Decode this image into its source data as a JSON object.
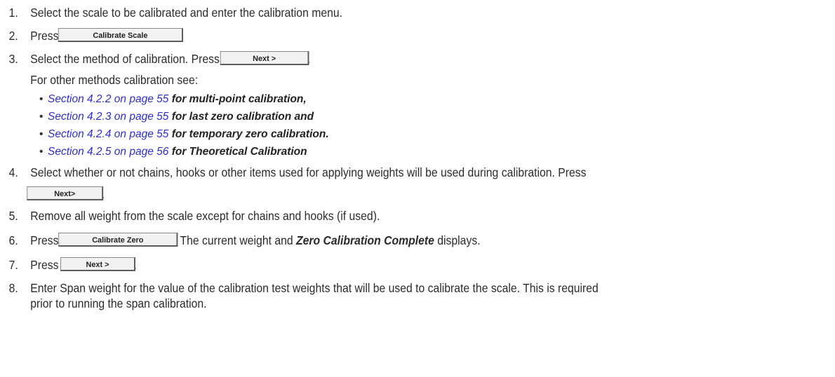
{
  "steps": [
    {
      "num": "1.",
      "text": "Select the scale to be calibrated and enter the calibration menu."
    },
    {
      "num": "2.",
      "pre": "Press",
      "button": "Calibrate Scale",
      "post": "."
    },
    {
      "num": "3.",
      "pre": "Select the method of calibration. Press",
      "button": "Next >",
      "post": "."
    },
    {
      "sub": "For other methods calibration see:"
    },
    {
      "num": "4.",
      "text": "Select whether or not chains, hooks or other items used for applying weights will be used during calibration. Press"
    },
    {
      "button_only": "Next>",
      "post": "."
    },
    {
      "num": "5.",
      "text": "Remove all weight from the scale except for chains and hooks (if used)."
    },
    {
      "num": "6.",
      "pre": "Press",
      "button": "Calibrate Zero",
      "post": ". The current weight and",
      "emph": "Zero Calibration Complete",
      "post2": "displays."
    },
    {
      "num": "7.",
      "pre": "Press",
      "button": "Next >",
      "post": "."
    },
    {
      "num": "8.",
      "text": "Enter Span weight for the value of the calibration test weights that will be used to calibrate the scale. This is required"
    },
    {
      "cont": "prior to running the span calibration."
    }
  ],
  "bullets": [
    {
      "link": "Section 4.2.2 on page 55",
      "tail": "for multi-point calibration,"
    },
    {
      "link": "Section 4.2.3 on page 55",
      "tail": "for last zero calibration and"
    },
    {
      "link": "Section 4.2.4 on page 55",
      "tail": "for temporary zero calibration."
    },
    {
      "link": "Section 4.2.5 on page 56",
      "tail": "for Theoretical Calibration"
    }
  ],
  "bullet_symbol": "•"
}
